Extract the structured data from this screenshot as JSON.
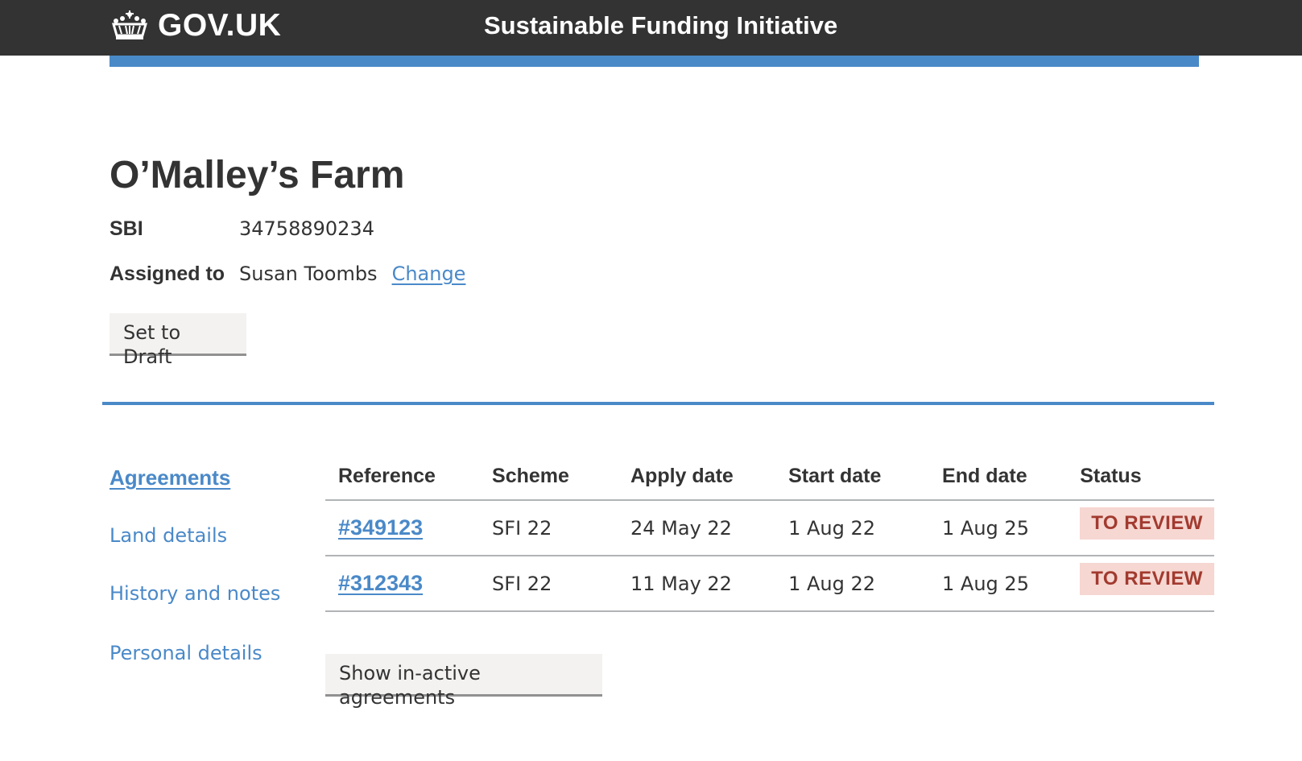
{
  "header": {
    "logo_text": "GOV.UK",
    "service_name": "Sustainable Funding Initiative"
  },
  "farm": {
    "name": "O’Malley’s Farm",
    "sbi_label": "SBI",
    "sbi_value": "34758890234",
    "assigned_label": "Assigned to",
    "assigned_value": "Susan Toombs",
    "change_label": "Change"
  },
  "actions": {
    "set_to_draft_label": "Set to Draft",
    "show_inactive_label": "Show in-active agreements"
  },
  "side_nav": {
    "items": [
      {
        "label": "Agreements",
        "active": true
      },
      {
        "label": "Land details",
        "active": false
      },
      {
        "label": "History and notes",
        "active": false
      },
      {
        "label": "Personal details",
        "active": false
      }
    ]
  },
  "agreements": {
    "headers": [
      "Reference",
      "Scheme",
      "Apply date",
      "Start date",
      "End date",
      "Status"
    ],
    "rows": [
      {
        "reference": "#349123",
        "scheme": "SFI 22",
        "apply_date": "24 May 22",
        "start_date": "1 Aug 22",
        "end_date": "1 Aug 25",
        "status": "TO REVIEW"
      },
      {
        "reference": "#312343",
        "scheme": "SFI 22",
        "apply_date": "11 May 22",
        "start_date": "1 Aug 22",
        "end_date": "1 Aug 25",
        "status": "TO REVIEW"
      }
    ]
  },
  "colors": {
    "header_bg": "#333333",
    "accent_blue": "#4a89c8",
    "status_tag_bg": "#f6d7d2",
    "status_tag_text": "#a23a2f",
    "button_bg": "#f3f2f1"
  },
  "icons": {
    "logo": "crown-icon"
  }
}
